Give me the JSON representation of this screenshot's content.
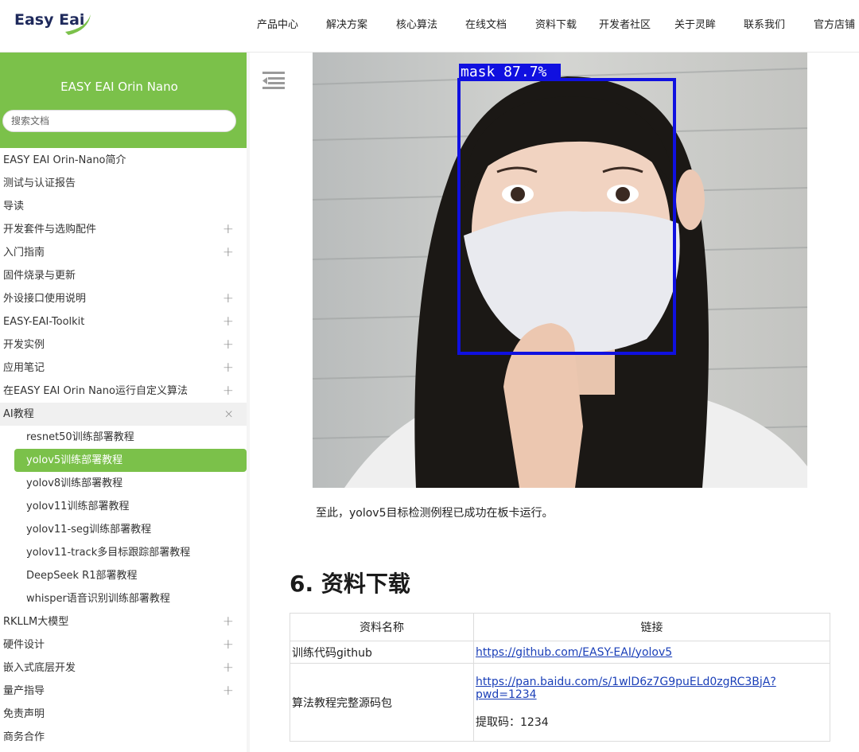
{
  "logo": {
    "text": "Easy Eai"
  },
  "nav": {
    "items": [
      "产品中心",
      "解决方案",
      "核心算法",
      "在线文档",
      "资料下载",
      "开发者社区",
      "关于灵眸",
      "联系我们",
      "官方店铺"
    ]
  },
  "sidebar": {
    "title": "EASY EAI Orin Nano",
    "search_placeholder": "搜索文档",
    "plus": "+",
    "close": "×",
    "items": [
      "EASY EAI Orin-Nano简介",
      "测试与认证报告",
      "导读",
      "开发套件与选购配件",
      "入门指南",
      "固件烧录与更新",
      "外设接口使用说明",
      "EASY-EAI-Toolkit",
      "开发实例",
      "应用笔记",
      "在EASY EAI Orin Nano运行自定义算法",
      "AI教程",
      "resnet50训练部署教程",
      "yolov5训练部署教程",
      "yolov8训练部署教程",
      "yolov11训练部署教程",
      "yolov11-seg训练部署教程",
      "yolov11-track多目标跟踪部署教程",
      "DeepSeek R1部署教程",
      "whisper语音识别训练部署教程",
      "RKLLM大模型",
      "硬件设计",
      "嵌入式底层开发",
      "量产指导",
      "免责声明",
      "商务合作"
    ]
  },
  "content": {
    "detection_label": "mask 87.7%",
    "caption": "至此，yolov5目标检测例程已成功在板卡运行。",
    "section_heading": "6. 资料下载",
    "table": {
      "headers": [
        "资料名称",
        "链接"
      ],
      "rows": [
        {
          "name": "训练代码github",
          "link": "https://github.com/EASY-EAI/yolov5"
        },
        {
          "name": "算法教程完整源码包",
          "link_line1": "https://pan.baidu.com/s/1wlD6z7G9puELd0zgRC3BjA?",
          "link_line2": "pwd=1234",
          "code": "提取码：1234"
        }
      ]
    }
  },
  "colors": {
    "accent_green": "#7bc14a",
    "link_blue": "#1a3fb8",
    "bbox_blue": "#1010e0"
  }
}
